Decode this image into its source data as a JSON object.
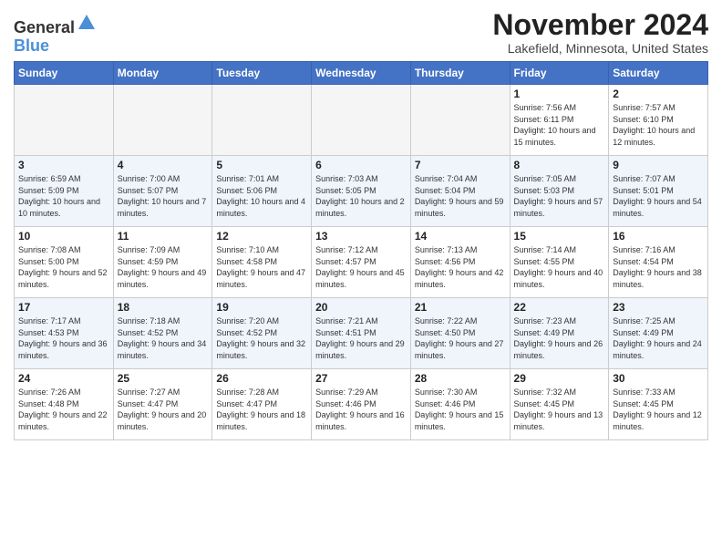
{
  "logo": {
    "general": "General",
    "blue": "Blue"
  },
  "header": {
    "month": "November 2024",
    "location": "Lakefield, Minnesota, United States"
  },
  "weekdays": [
    "Sunday",
    "Monday",
    "Tuesday",
    "Wednesday",
    "Thursday",
    "Friday",
    "Saturday"
  ],
  "weeks": [
    [
      {
        "day": "",
        "info": ""
      },
      {
        "day": "",
        "info": ""
      },
      {
        "day": "",
        "info": ""
      },
      {
        "day": "",
        "info": ""
      },
      {
        "day": "",
        "info": ""
      },
      {
        "day": "1",
        "info": "Sunrise: 7:56 AM\nSunset: 6:11 PM\nDaylight: 10 hours and 15 minutes."
      },
      {
        "day": "2",
        "info": "Sunrise: 7:57 AM\nSunset: 6:10 PM\nDaylight: 10 hours and 12 minutes."
      }
    ],
    [
      {
        "day": "3",
        "info": "Sunrise: 6:59 AM\nSunset: 5:09 PM\nDaylight: 10 hours and 10 minutes."
      },
      {
        "day": "4",
        "info": "Sunrise: 7:00 AM\nSunset: 5:07 PM\nDaylight: 10 hours and 7 minutes."
      },
      {
        "day": "5",
        "info": "Sunrise: 7:01 AM\nSunset: 5:06 PM\nDaylight: 10 hours and 4 minutes."
      },
      {
        "day": "6",
        "info": "Sunrise: 7:03 AM\nSunset: 5:05 PM\nDaylight: 10 hours and 2 minutes."
      },
      {
        "day": "7",
        "info": "Sunrise: 7:04 AM\nSunset: 5:04 PM\nDaylight: 9 hours and 59 minutes."
      },
      {
        "day": "8",
        "info": "Sunrise: 7:05 AM\nSunset: 5:03 PM\nDaylight: 9 hours and 57 minutes."
      },
      {
        "day": "9",
        "info": "Sunrise: 7:07 AM\nSunset: 5:01 PM\nDaylight: 9 hours and 54 minutes."
      }
    ],
    [
      {
        "day": "10",
        "info": "Sunrise: 7:08 AM\nSunset: 5:00 PM\nDaylight: 9 hours and 52 minutes."
      },
      {
        "day": "11",
        "info": "Sunrise: 7:09 AM\nSunset: 4:59 PM\nDaylight: 9 hours and 49 minutes."
      },
      {
        "day": "12",
        "info": "Sunrise: 7:10 AM\nSunset: 4:58 PM\nDaylight: 9 hours and 47 minutes."
      },
      {
        "day": "13",
        "info": "Sunrise: 7:12 AM\nSunset: 4:57 PM\nDaylight: 9 hours and 45 minutes."
      },
      {
        "day": "14",
        "info": "Sunrise: 7:13 AM\nSunset: 4:56 PM\nDaylight: 9 hours and 42 minutes."
      },
      {
        "day": "15",
        "info": "Sunrise: 7:14 AM\nSunset: 4:55 PM\nDaylight: 9 hours and 40 minutes."
      },
      {
        "day": "16",
        "info": "Sunrise: 7:16 AM\nSunset: 4:54 PM\nDaylight: 9 hours and 38 minutes."
      }
    ],
    [
      {
        "day": "17",
        "info": "Sunrise: 7:17 AM\nSunset: 4:53 PM\nDaylight: 9 hours and 36 minutes."
      },
      {
        "day": "18",
        "info": "Sunrise: 7:18 AM\nSunset: 4:52 PM\nDaylight: 9 hours and 34 minutes."
      },
      {
        "day": "19",
        "info": "Sunrise: 7:20 AM\nSunset: 4:52 PM\nDaylight: 9 hours and 32 minutes."
      },
      {
        "day": "20",
        "info": "Sunrise: 7:21 AM\nSunset: 4:51 PM\nDaylight: 9 hours and 29 minutes."
      },
      {
        "day": "21",
        "info": "Sunrise: 7:22 AM\nSunset: 4:50 PM\nDaylight: 9 hours and 27 minutes."
      },
      {
        "day": "22",
        "info": "Sunrise: 7:23 AM\nSunset: 4:49 PM\nDaylight: 9 hours and 26 minutes."
      },
      {
        "day": "23",
        "info": "Sunrise: 7:25 AM\nSunset: 4:49 PM\nDaylight: 9 hours and 24 minutes."
      }
    ],
    [
      {
        "day": "24",
        "info": "Sunrise: 7:26 AM\nSunset: 4:48 PM\nDaylight: 9 hours and 22 minutes."
      },
      {
        "day": "25",
        "info": "Sunrise: 7:27 AM\nSunset: 4:47 PM\nDaylight: 9 hours and 20 minutes."
      },
      {
        "day": "26",
        "info": "Sunrise: 7:28 AM\nSunset: 4:47 PM\nDaylight: 9 hours and 18 minutes."
      },
      {
        "day": "27",
        "info": "Sunrise: 7:29 AM\nSunset: 4:46 PM\nDaylight: 9 hours and 16 minutes."
      },
      {
        "day": "28",
        "info": "Sunrise: 7:30 AM\nSunset: 4:46 PM\nDaylight: 9 hours and 15 minutes."
      },
      {
        "day": "29",
        "info": "Sunrise: 7:32 AM\nSunset: 4:45 PM\nDaylight: 9 hours and 13 minutes."
      },
      {
        "day": "30",
        "info": "Sunrise: 7:33 AM\nSunset: 4:45 PM\nDaylight: 9 hours and 12 minutes."
      }
    ]
  ]
}
